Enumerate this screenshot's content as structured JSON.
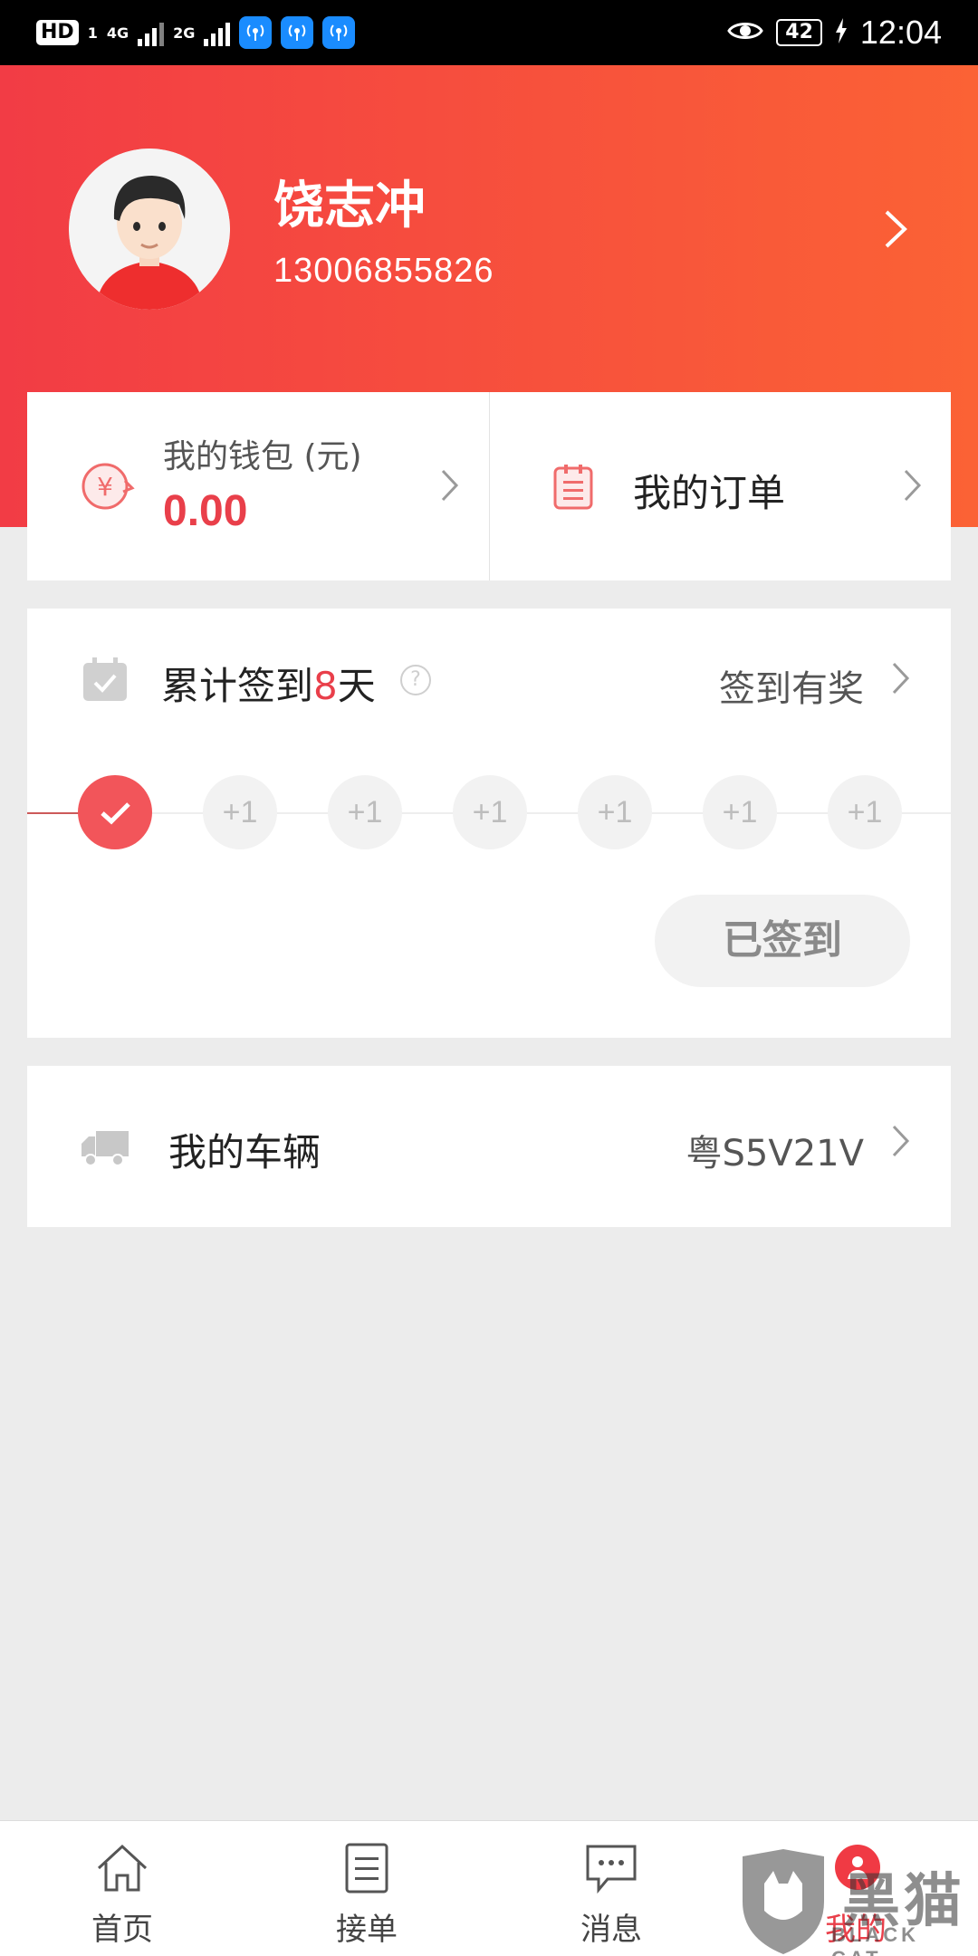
{
  "status_bar": {
    "hd": "HD",
    "sim1": "1",
    "net1": "4G",
    "net2": "2G",
    "battery": "42",
    "time": "12:04"
  },
  "profile": {
    "name": "饶志冲",
    "phone": "13006855826"
  },
  "wallet": {
    "label": "我的钱包 (元)",
    "amount": "0.00"
  },
  "orders": {
    "label": "我的订单"
  },
  "signin": {
    "prefix": "累计签到",
    "days": "8",
    "suffix": "天",
    "help": "?",
    "reward_label": "签到有奖",
    "steps": [
      "+1",
      "+1",
      "+1",
      "+1",
      "+1",
      "+1"
    ],
    "button_label": "已签到"
  },
  "vehicle": {
    "label": "我的车辆",
    "plate": "粤S5V21V"
  },
  "nav": {
    "items": [
      {
        "label": "首页",
        "icon": "home-icon"
      },
      {
        "label": "接单",
        "icon": "list-icon"
      },
      {
        "label": "消息",
        "icon": "message-icon"
      },
      {
        "label": "我的",
        "icon": "profile-icon"
      }
    ]
  },
  "watermark": {
    "cn": "黑猫",
    "en": "BLACK CAT"
  },
  "colors": {
    "accent": "#e93f4a",
    "header_start": "#f23c45",
    "header_end": "#fb6235"
  }
}
